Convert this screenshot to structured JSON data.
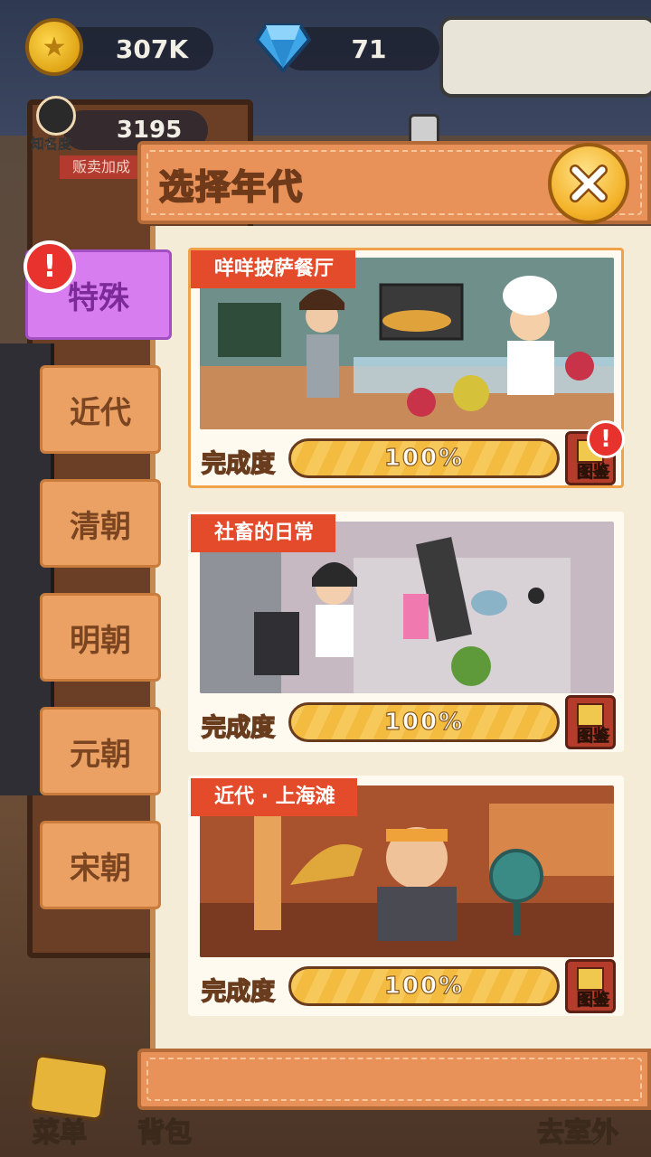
{
  "hud": {
    "coins": "307K",
    "gems": "71",
    "fame_value": "3195",
    "fame_label": "知名度",
    "sale_bonus": "贩卖加成"
  },
  "panel": {
    "title": "选择年代"
  },
  "tabs": [
    {
      "label": "特殊",
      "active": true,
      "alert": "!"
    },
    {
      "label": "近代"
    },
    {
      "label": "清朝"
    },
    {
      "label": "明朝"
    },
    {
      "label": "元朝"
    },
    {
      "label": "宋朝"
    }
  ],
  "cards": [
    {
      "title": "咩咩披萨餐厅",
      "progress_label": "完成度",
      "progress_text": "100%",
      "progress": 1.0,
      "book_label": "图鉴",
      "alert": "!"
    },
    {
      "title": "社畜的日常",
      "progress_label": "完成度",
      "progress_text": "100%",
      "progress": 1.0,
      "book_label": "图鉴"
    },
    {
      "title": "近代 · 上海滩",
      "progress_label": "完成度",
      "progress_text": "100%",
      "progress": 1.0,
      "book_label": "图鉴"
    }
  ],
  "bottom_nav": {
    "menu": "菜单",
    "backpack": "背包",
    "outdoor": "去室外"
  },
  "colors": {
    "tab_active": "#d77df0",
    "tab": "#eba164",
    "ribbon": "#e34b2b",
    "alert": "#e8322e",
    "panel_header": "#e8925a"
  }
}
